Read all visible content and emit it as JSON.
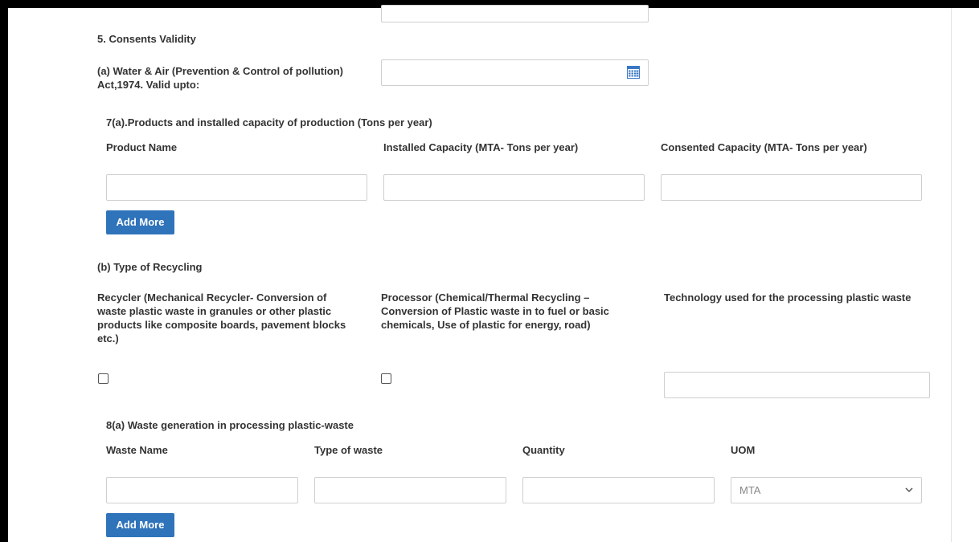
{
  "sections": {
    "consents": {
      "heading": "5. Consents Validity",
      "water_air_label_line1": "(a) Water & Air (Prevention & Control of pollution)",
      "water_air_label_line2": "Act,1974. Valid upto:",
      "date_value": ""
    },
    "products": {
      "heading": "7(a).Products and installed capacity of production (Tons per year)",
      "col_product_name": "Product Name",
      "col_installed_capacity": "Installed Capacity (MTA- Tons per year)",
      "col_consented_capacity": "Consented Capacity (MTA- Tons per year)",
      "product_name_value": "",
      "installed_capacity_value": "",
      "consented_capacity_value": "",
      "add_more_label": "Add More"
    },
    "recycling": {
      "heading": "(b) Type of Recycling",
      "recycler_line1": "Recycler (Mechanical Recycler- Conversion of",
      "recycler_line2": "waste plastic waste in granules or other plastic",
      "recycler_line3": "products like composite boards, pavement blocks",
      "recycler_line4": "etc.)",
      "processor_line1": "Processor (Chemical/Thermal Recycling –",
      "processor_line2": "Conversion of Plastic waste in to fuel or basic",
      "processor_line3": "chemicals, Use of plastic for energy, road)",
      "technology_label": "Technology used for the processing plastic waste",
      "recycler_checked": false,
      "processor_checked": false,
      "technology_value": ""
    },
    "waste": {
      "heading": "8(a) Waste generation in processing plastic-waste",
      "col_waste_name": "Waste Name",
      "col_type_of_waste": "Type of waste",
      "col_quantity": "Quantity",
      "col_uom": "UOM",
      "waste_name_value": "",
      "type_of_waste_value": "",
      "quantity_value": "",
      "uom_selected": "MTA",
      "add_more_label": "Add More"
    }
  },
  "icons": {
    "calendar": "calendar-icon",
    "chevron": "chevron-down-icon"
  },
  "colors": {
    "button_bg": "#2f73ba",
    "calendar_icon": "#3a77c6",
    "frame": "#000000"
  }
}
